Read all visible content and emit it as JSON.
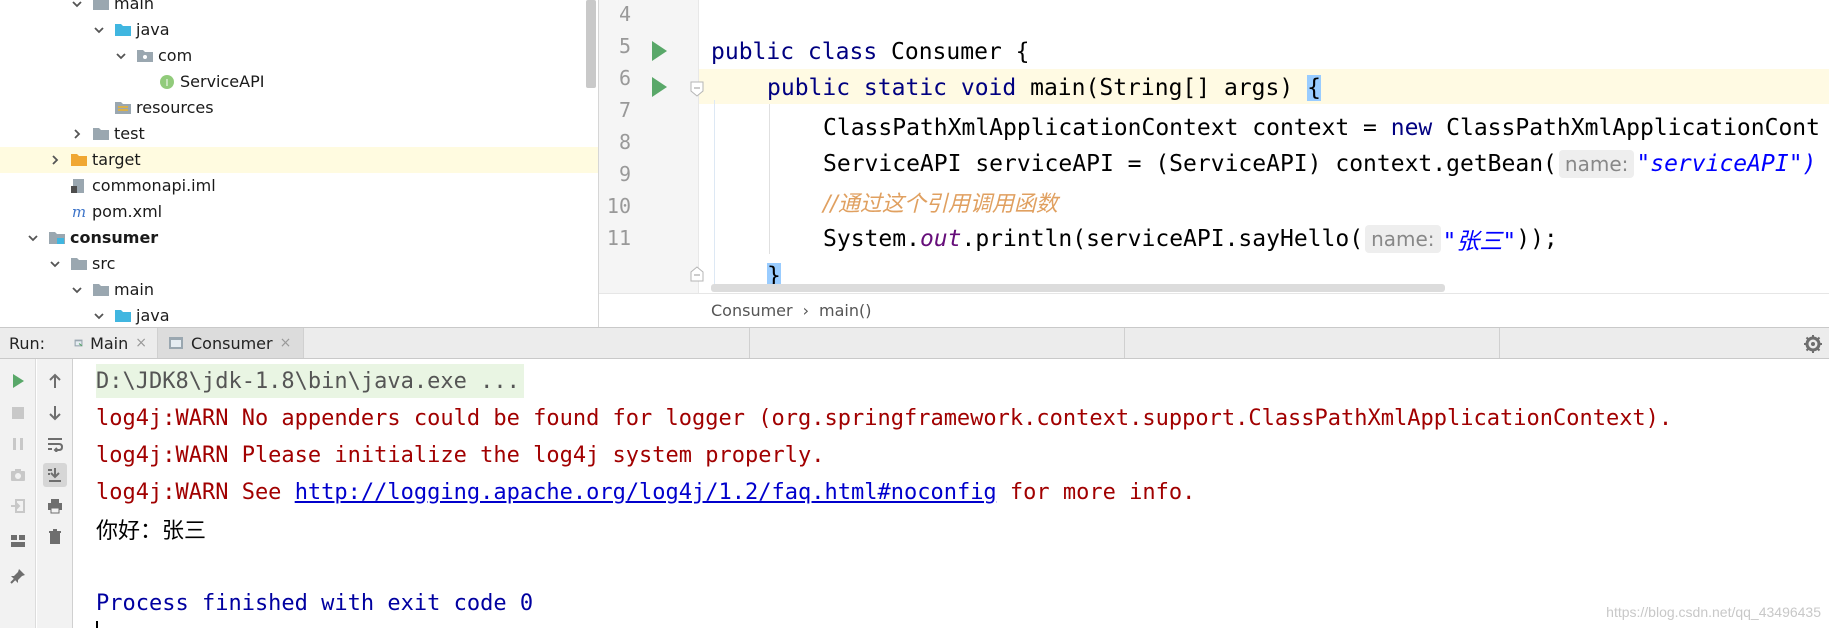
{
  "project_tree": {
    "items": [
      {
        "label": "main",
        "depth": 3,
        "expanded": true,
        "icon": "folder-icon"
      },
      {
        "label": "java",
        "depth": 4,
        "expanded": true,
        "icon": "source-folder-icon"
      },
      {
        "label": "com",
        "depth": 5,
        "expanded": true,
        "icon": "package-icon"
      },
      {
        "label": "ServiceAPI",
        "depth": 6,
        "icon": "interface-icon"
      },
      {
        "label": "resources",
        "depth": 4,
        "icon": "resources-folder-icon"
      },
      {
        "label": "test",
        "depth": 3,
        "expanded": false,
        "icon": "folder-icon"
      },
      {
        "label": "target",
        "depth": 2,
        "expanded": false,
        "icon": "excluded-folder-icon",
        "selected": true
      },
      {
        "label": "commonapi.iml",
        "depth": 2,
        "icon": "iml-file-icon"
      },
      {
        "label": "pom.xml",
        "depth": 2,
        "icon": "maven-icon"
      },
      {
        "label": "consumer",
        "depth": 1,
        "expanded": true,
        "icon": "module-icon",
        "bold": true
      },
      {
        "label": "src",
        "depth": 2,
        "expanded": true,
        "icon": "folder-icon"
      },
      {
        "label": "main",
        "depth": 3,
        "expanded": true,
        "icon": "folder-icon"
      },
      {
        "label": "java",
        "depth": 4,
        "expanded": true,
        "icon": "source-folder-icon"
      }
    ]
  },
  "editor": {
    "line_numbers": [
      "4",
      "5",
      "6",
      "7",
      "8",
      "9",
      "10",
      "11"
    ],
    "line5": {
      "kw": "public class ",
      "name": "Consumer {"
    },
    "line6": {
      "kw": "public static void ",
      "rest": "main(String[] args) ",
      "brace": "{"
    },
    "line7": {
      "text": "ClassPathXmlApplicationContext context = ",
      "kw": "new",
      "rest": " ClassPathXmlApplicationCont"
    },
    "line8": {
      "text": "ServiceAPI serviceAPI = (ServiceAPI) context.getBean(",
      "hint": "name:",
      "str": "\"serviceAPI\")"
    },
    "line9": {
      "comment": "//通过这个引用调用函数"
    },
    "line10": {
      "pre": "System.",
      "field": "out",
      "mid": ".println(serviceAPI.sayHello(",
      "hint": "name:",
      "str": "\"张三\"",
      "post": "));"
    },
    "line11": {
      "brace": "}"
    },
    "breadcrumb": {
      "class": "Consumer",
      "separator": "›",
      "method": "main()"
    }
  },
  "run_panel": {
    "label": "Run:",
    "tabs": [
      {
        "label": "Main",
        "close": "×",
        "active": false
      },
      {
        "label": "Consumer",
        "close": "×",
        "active": true
      }
    ],
    "console": {
      "command": "D:\\JDK8\\jdk-1.8\\bin\\java.exe ...",
      "warn1": "log4j:WARN No appenders could be found for logger (org.springframework.context.support.ClassPathXmlApplicationContext).",
      "warn2": "log4j:WARN Please initialize the log4j system properly.",
      "warn3_pre": "log4j:WARN See ",
      "warn3_link": "http://logging.apache.org/log4j/1.2/faq.html#noconfig",
      "warn3_post": " for more info.",
      "output": "你好：张三",
      "exit": "Process finished with exit code 0"
    }
  },
  "watermark": "https://blog.csdn.net/qq_43496435",
  "colors": {
    "keyword": "#000080",
    "comment": "#e0a060",
    "string": "#0000ff",
    "warn": "#a10000",
    "selection": "#fffbe0",
    "current_line": "#fffae3"
  }
}
